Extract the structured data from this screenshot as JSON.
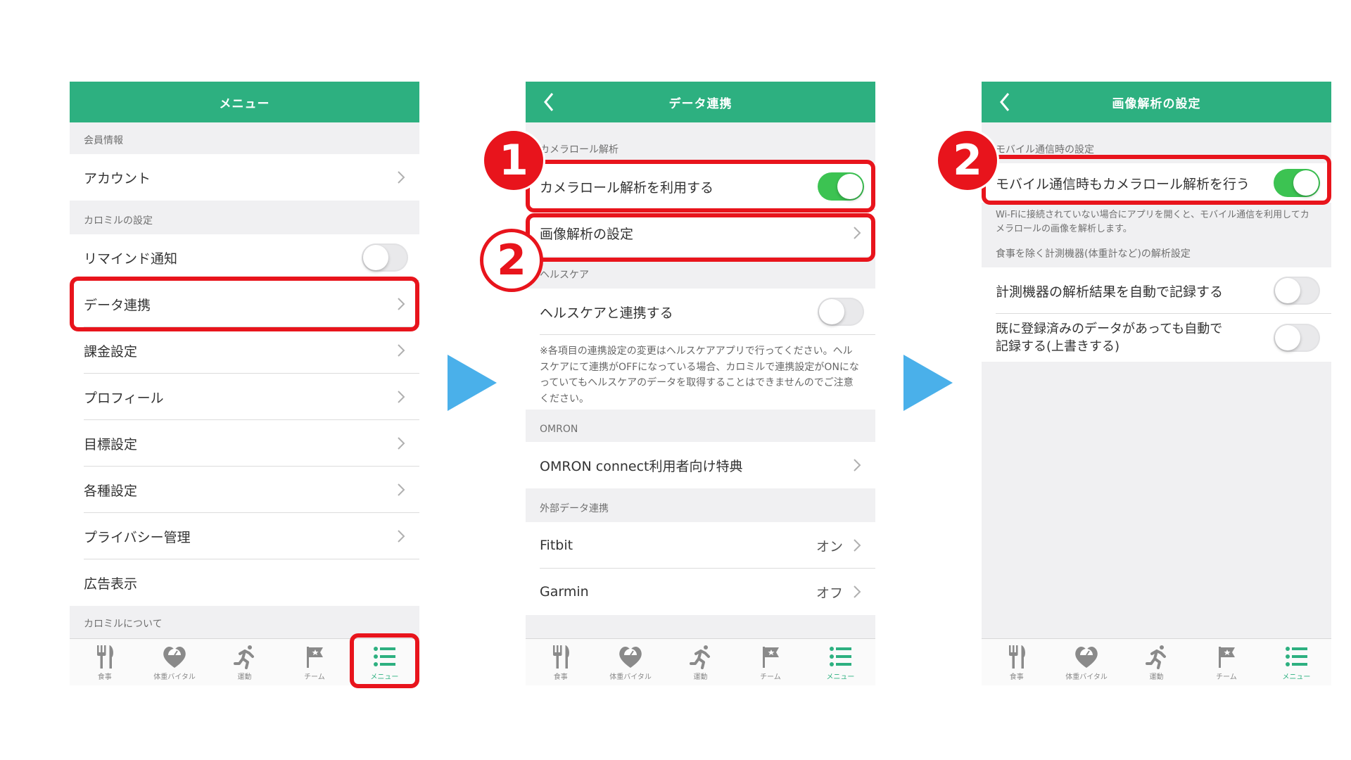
{
  "colors": {
    "accent": "#2db080",
    "toggle_on": "#3cc352",
    "highlight": "#e8141c",
    "arrow": "#4ab0ea"
  },
  "tabs": [
    {
      "label": "食事",
      "icon": "fork-knife-icon"
    },
    {
      "label": "体重バイタル",
      "icon": "heart-scale-icon"
    },
    {
      "label": "運動",
      "icon": "running-person-icon"
    },
    {
      "label": "チーム",
      "icon": "flag-icon"
    },
    {
      "label": "メニュー",
      "icon": "list-icon"
    }
  ],
  "screen1": {
    "title": "メニュー",
    "section_member": "会員情報",
    "account": "アカウント",
    "section_settings": "カロミルの設定",
    "remind": "リマインド通知",
    "data_link": "データ連携",
    "billing": "課金設定",
    "profile": "プロフィール",
    "goal": "目標設定",
    "various": "各種設定",
    "privacy": "プライバシー管理",
    "ads": "広告表示",
    "section_about": "カロミルについて"
  },
  "screen2": {
    "title": "データ連携",
    "section_camera": "カメラロール解析",
    "use_camera": "カメラロール解析を利用する",
    "image_settings": "画像解析の設定",
    "section_health": "ヘルスケア",
    "health_link": "ヘルスケアと連携する",
    "health_note": "※各項目の連携設定の変更はヘルスケアアプリで行ってください。ヘルスケアにて連携がOFFになっている場合、カロミルで連携設定がONになっていてもヘルスケアのデータを取得することはできませんのでご注意ください。",
    "section_omron": "OMRON",
    "omron_benefit": "OMRON connect利用者向け特典",
    "section_external": "外部データ連携",
    "fitbit": "Fitbit",
    "fitbit_value": "オン",
    "garmin": "Garmin",
    "garmin_value": "オフ"
  },
  "screen3": {
    "title": "画像解析の設定",
    "section_mobile": "モバイル通信時の設定",
    "mobile_analysis": "モバイル通信時もカメラロール解析を行う",
    "mobile_note": "Wi-Fiに接続されていない場合にアプリを開くと、モバイル通信を利用してカメラロールの画像を解析します。",
    "section_devices": "食事を除く計測機器(体重計など)の解析設定",
    "auto_record_line1": "計測機器の解析結果を自動で記録する",
    "overwrite_line1": "既に登録済みのデータがあっても自動で",
    "overwrite_line2": "記録する(上書きする)"
  },
  "markers": {
    "one": "1",
    "two": "2"
  },
  "toggles": {
    "remind": false,
    "use_camera": true,
    "health_link": false,
    "mobile_analysis": true,
    "auto_record": false,
    "overwrite": false
  }
}
